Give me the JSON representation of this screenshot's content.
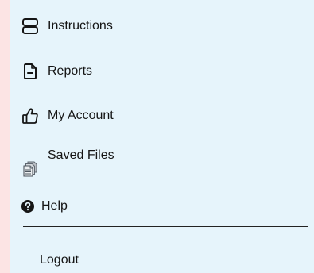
{
  "menu": {
    "items": [
      {
        "label": "Instructions",
        "icon": "server-icon"
      },
      {
        "label": "Reports",
        "icon": "document-minus-icon"
      },
      {
        "label": "My Account",
        "icon": "thumbs-up-icon"
      },
      {
        "label": "Saved Files",
        "icon": "files-stack-icon"
      },
      {
        "label": "Help",
        "icon": "question-circle-icon"
      }
    ],
    "logout_label": "Logout"
  },
  "colors": {
    "page_background": "#fce4e4",
    "panel_background": "#e6f4fb",
    "text": "#151515"
  }
}
